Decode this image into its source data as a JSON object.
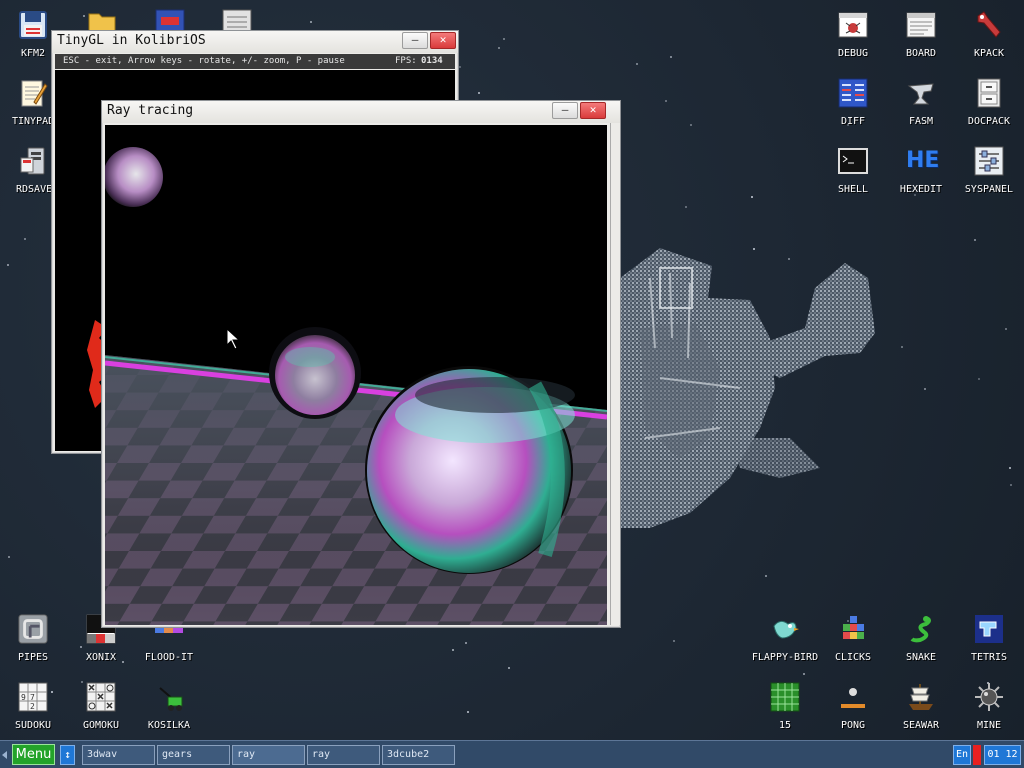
{
  "desktop": {
    "top_left": [
      {
        "label": "KFM2",
        "icon": "kfm2-floppy-icon"
      },
      {
        "label": "TINYPAD",
        "icon": "tinypad-notepad-icon"
      },
      {
        "label": "RDSAVE",
        "icon": "rdsave-icon"
      }
    ],
    "top_right": [
      {
        "label": "DEBUG",
        "icon": "debug-icon"
      },
      {
        "label": "BOARD",
        "icon": "board-icon"
      },
      {
        "label": "KPACK",
        "icon": "kpack-wrench-icon"
      },
      {
        "label": "DIFF",
        "icon": "diff-icon"
      },
      {
        "label": "FASM",
        "icon": "fasm-anvil-icon"
      },
      {
        "label": "DOCPACK",
        "icon": "docpack-cabinet-icon"
      },
      {
        "label": "SHELL",
        "icon": "shell-terminal-icon"
      },
      {
        "label": "HEXEDIT",
        "icon": "hexedit-icon"
      },
      {
        "label": "SYSPANEL",
        "icon": "syspanel-sliders-icon"
      }
    ],
    "bottom_left": [
      {
        "label": "PIPES",
        "icon": "pipes-icon"
      },
      {
        "label": "XONIX",
        "icon": "xonix-icon"
      },
      {
        "label": "FLOOD-IT",
        "icon": "flood-it-icon"
      },
      {
        "label": "SUDOKU",
        "icon": "sudoku-icon"
      },
      {
        "label": "GOMOKU",
        "icon": "gomoku-icon"
      },
      {
        "label": "KOSILKA",
        "icon": "kosilka-mower-icon"
      }
    ],
    "bottom_right": [
      {
        "label": "FLAPPY-BIRD",
        "icon": "flappy-bird-icon"
      },
      {
        "label": "CLICKS",
        "icon": "clicks-icon"
      },
      {
        "label": "SNAKE",
        "icon": "snake-icon"
      },
      {
        "label": "TETRIS",
        "icon": "tetris-icon"
      },
      {
        "label": "15",
        "icon": "fifteen-puzzle-icon"
      },
      {
        "label": "PONG",
        "icon": "pong-icon"
      },
      {
        "label": "SEAWAR",
        "icon": "seawar-ship-icon"
      },
      {
        "label": "MINE",
        "icon": "mine-icon"
      }
    ],
    "sudoku_digits": [
      "9",
      "7",
      "2"
    ]
  },
  "tinygl_window": {
    "title": "TinyGL in KolibriOS",
    "status": "ESC - exit, Arrow keys - rotate, +/- zoom, P - pause",
    "fps_label": "FPS:",
    "fps_value": "0134",
    "minimize": "—",
    "close": "✕"
  },
  "ray_window": {
    "title": "Ray tracing",
    "minimize": "—",
    "close": "✕"
  },
  "hexedit_logo": "HE",
  "taskbar": {
    "menu": "Menu",
    "switch_icon": "↕",
    "tasks": [
      "3dwav",
      "gears",
      "ray",
      "ray",
      "3dcube2"
    ],
    "lang": "En",
    "time_h": "01",
    "time_m": "12"
  },
  "colors": {
    "taskbar": "#314a68",
    "desktop": "#1f2a36",
    "menu_green": "#23a32a",
    "close_red": "#d93b3b"
  }
}
